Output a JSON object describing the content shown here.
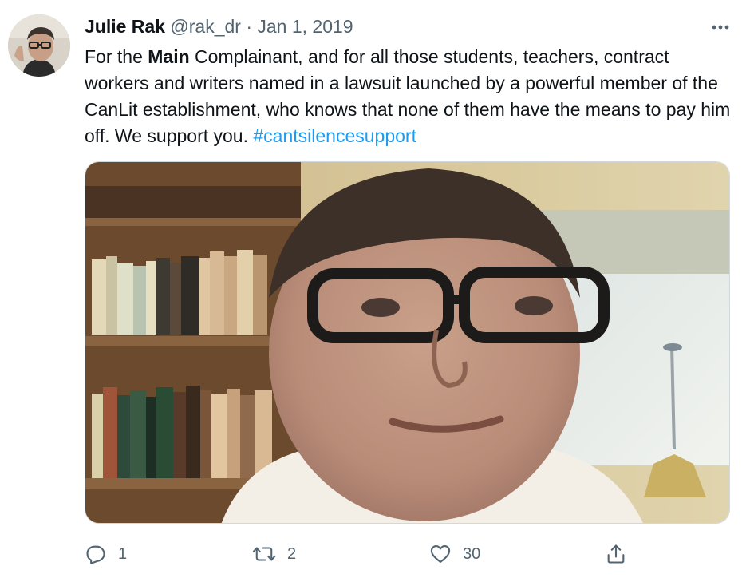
{
  "tweet": {
    "author_name": "Julie Rak",
    "author_handle": "@rak_dr",
    "separator": "·",
    "date": "Jan 1, 2019",
    "text_part1": "For the ",
    "text_bold": "Main",
    "text_part2": " Complainant, and for all those students, teachers, contract workers and writers named in a lawsuit launched by a powerful member of the CanLit establishment, who knows that none of them have the means to pay him off.  We support you. ",
    "hashtag": "#cantsilencesupport"
  },
  "actions": {
    "reply_count": "1",
    "retweet_count": "2",
    "like_count": "30"
  },
  "icons": {
    "more": "more-horizontal-icon",
    "reply": "reply-icon",
    "retweet": "retweet-icon",
    "like": "heart-icon",
    "share": "share-icon"
  },
  "colors": {
    "text": "#0f1419",
    "muted": "#536471",
    "link": "#1d9bf0"
  }
}
